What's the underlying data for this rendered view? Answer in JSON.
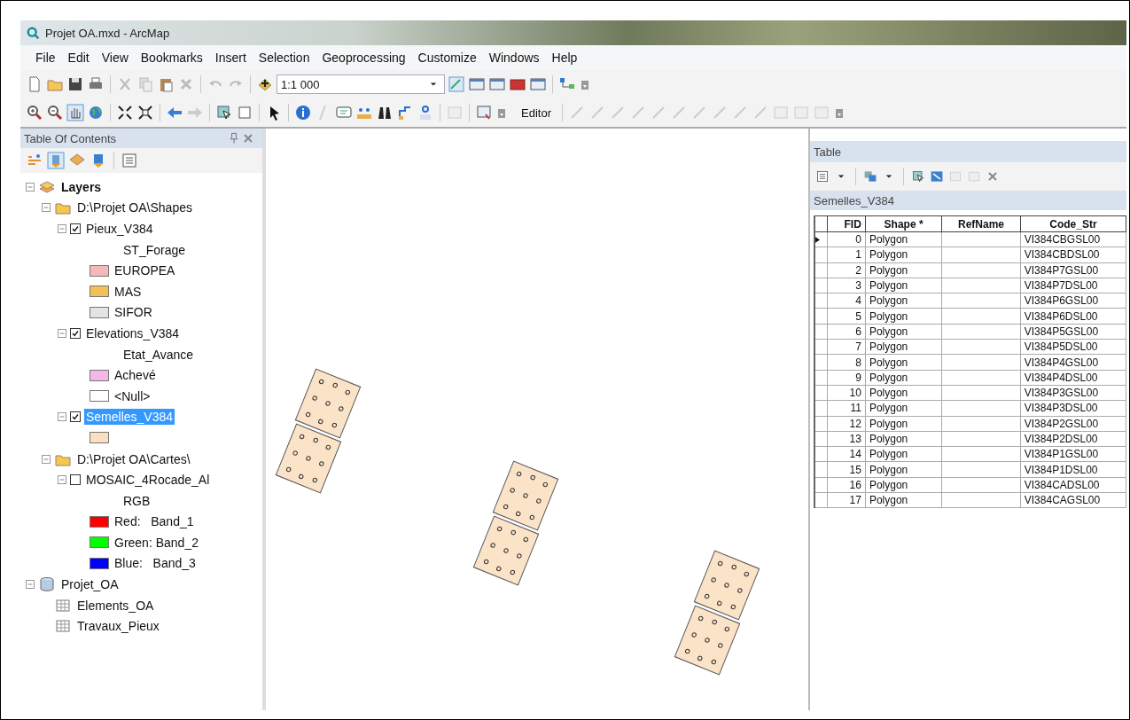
{
  "window": {
    "title": "Projet OA.mxd - ArcMap"
  },
  "menu": [
    "File",
    "Edit",
    "View",
    "Bookmarks",
    "Insert",
    "Selection",
    "Geoprocessing",
    "Customize",
    "Windows",
    "Help"
  ],
  "toolbar": {
    "scale": "1:1 000",
    "editor": "Editor"
  },
  "toc": {
    "title": "Table Of Contents",
    "tree": [
      {
        "kind": "group",
        "label": "Layers",
        "expanded": true,
        "children": [
          {
            "kind": "folder",
            "label": "D:\\Projet OA\\Shapes",
            "expanded": true,
            "children": [
              {
                "kind": "layer",
                "label": "Pieux_V384",
                "expanded": true,
                "checked": true,
                "selected": false,
                "children": [
                  {
                    "kind": "field",
                    "label": "ST_Forage"
                  },
                  {
                    "kind": "swatch",
                    "label": "EUROPEA",
                    "color": "#f4b8b8"
                  },
                  {
                    "kind": "swatch",
                    "label": "MAS",
                    "color": "#f2c15a"
                  },
                  {
                    "kind": "swatch",
                    "label": "SIFOR",
                    "color": "#e4e4e4"
                  }
                ]
              },
              {
                "kind": "layer",
                "label": "Elevations_V384",
                "expanded": true,
                "checked": true,
                "selected": false,
                "children": [
                  {
                    "kind": "field",
                    "label": "Etat_Avance"
                  },
                  {
                    "kind": "swatch",
                    "label": "Achevé",
                    "color": "#f5b8e6"
                  },
                  {
                    "kind": "swatch",
                    "label": "<Null>",
                    "color": "#ffffff"
                  }
                ]
              },
              {
                "kind": "layer",
                "label": "Semelles_V384",
                "expanded": true,
                "checked": true,
                "selected": true,
                "children": [
                  {
                    "kind": "swatch",
                    "color": "#fae0c0"
                  }
                ]
              }
            ]
          },
          {
            "kind": "folder",
            "label": "D:\\Projet OA\\Cartes\\",
            "expanded": true,
            "children": [
              {
                "kind": "layer",
                "label": "MOSAIC_4Rocade_Al",
                "expanded": true,
                "checked": false,
                "selected": false,
                "children": [
                  {
                    "kind": "field",
                    "label": "RGB"
                  },
                  {
                    "kind": "swatch",
                    "label": "Red:   Band_1",
                    "color": "#ff0000"
                  },
                  {
                    "kind": "swatch",
                    "label": "Green: Band_2",
                    "color": "#00ff00"
                  },
                  {
                    "kind": "swatch",
                    "label": "Blue:   Band_3",
                    "color": "#0000ff"
                  }
                ]
              }
            ]
          }
        ]
      },
      {
        "kind": "database",
        "label": "Projet_OA",
        "expanded": true,
        "children": [
          {
            "kind": "table",
            "label": "Elements_OA"
          },
          {
            "kind": "table",
            "label": "Travaux_Pieux"
          }
        ]
      }
    ]
  },
  "table": {
    "title": "Table",
    "layer_tab": "Semelles_V384",
    "columns": [
      "FID",
      "Shape *",
      "RefName",
      "Code_Str"
    ],
    "rows": [
      {
        "cells": [
          "0",
          "Polygon",
          "",
          "VI384CBGSL00"
        ],
        "current": true
      },
      {
        "cells": [
          "1",
          "Polygon",
          "",
          "VI384CBDSL00"
        ],
        "current": false
      },
      {
        "cells": [
          "2",
          "Polygon",
          "",
          "VI384P7GSL00"
        ],
        "current": false
      },
      {
        "cells": [
          "3",
          "Polygon",
          "",
          "VI384P7DSL00"
        ],
        "current": false
      },
      {
        "cells": [
          "4",
          "Polygon",
          "",
          "VI384P6GSL00"
        ],
        "current": false
      },
      {
        "cells": [
          "5",
          "Polygon",
          "",
          "VI384P6DSL00"
        ],
        "current": false
      },
      {
        "cells": [
          "6",
          "Polygon",
          "",
          "VI384P5GSL00"
        ],
        "current": false
      },
      {
        "cells": [
          "7",
          "Polygon",
          "",
          "VI384P5DSL00"
        ],
        "current": false
      },
      {
        "cells": [
          "8",
          "Polygon",
          "",
          "VI384P4GSL00"
        ],
        "current": false
      },
      {
        "cells": [
          "9",
          "Polygon",
          "",
          "VI384P4DSL00"
        ],
        "current": false
      },
      {
        "cells": [
          "10",
          "Polygon",
          "",
          "VI384P3GSL00"
        ],
        "current": false
      },
      {
        "cells": [
          "11",
          "Polygon",
          "",
          "VI384P3DSL00"
        ],
        "current": false
      },
      {
        "cells": [
          "12",
          "Polygon",
          "",
          "VI384P2GSL00"
        ],
        "current": false
      },
      {
        "cells": [
          "13",
          "Polygon",
          "",
          "VI384P2DSL00"
        ],
        "current": false
      },
      {
        "cells": [
          "14",
          "Polygon",
          "",
          "VI384P1GSL00"
        ],
        "current": false
      },
      {
        "cells": [
          "15",
          "Polygon",
          "",
          "VI384P1DSL00"
        ],
        "current": false
      },
      {
        "cells": [
          "16",
          "Polygon",
          "",
          "VI384CADSL00"
        ],
        "current": false
      },
      {
        "cells": [
          "17",
          "Polygon",
          "",
          "VI384CAGSL00"
        ],
        "current": false
      }
    ]
  }
}
